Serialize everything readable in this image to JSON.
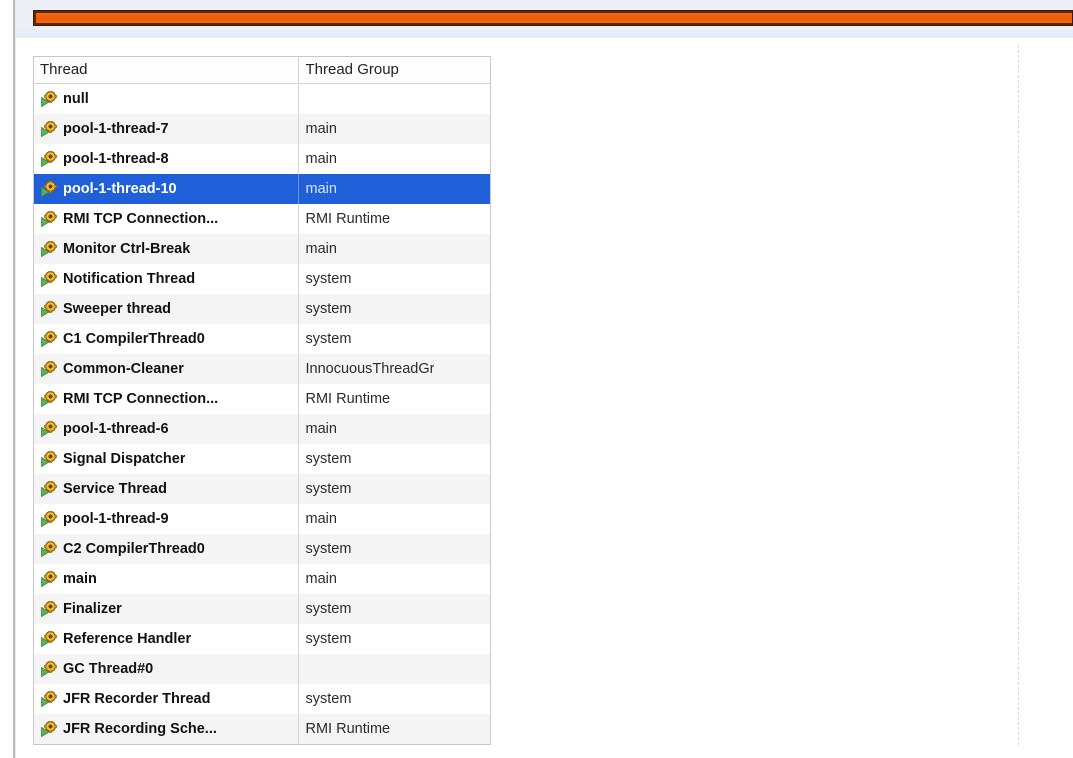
{
  "window": {
    "progress_bar": {
      "name": "orange-level-bar",
      "fill_color": "#ef5f06",
      "border_color": "#5d2a09",
      "fill_percent": 100
    }
  },
  "thread_table": {
    "columns": [
      "Thread",
      "Thread Group"
    ],
    "selected_row_index": 3,
    "selection_color": "#1f5fd8",
    "row_icon": "thread-run-gear-icon",
    "rows": [
      {
        "thread": "null",
        "group": ""
      },
      {
        "thread": "pool-1-thread-7",
        "group": "main"
      },
      {
        "thread": "pool-1-thread-8",
        "group": "main"
      },
      {
        "thread": "pool-1-thread-10",
        "group": "main"
      },
      {
        "thread": "RMI TCP Connection...",
        "group": "RMI Runtime"
      },
      {
        "thread": "Monitor Ctrl-Break",
        "group": "main"
      },
      {
        "thread": "Notification Thread",
        "group": "system"
      },
      {
        "thread": "Sweeper thread",
        "group": "system"
      },
      {
        "thread": "C1 CompilerThread0",
        "group": "system"
      },
      {
        "thread": "Common-Cleaner",
        "group": "InnocuousThreadGr"
      },
      {
        "thread": "RMI TCP Connection...",
        "group": "RMI Runtime"
      },
      {
        "thread": "pool-1-thread-6",
        "group": "main"
      },
      {
        "thread": "Signal Dispatcher",
        "group": "system"
      },
      {
        "thread": "Service Thread",
        "group": "system"
      },
      {
        "thread": "pool-1-thread-9",
        "group": "main"
      },
      {
        "thread": "C2 CompilerThread0",
        "group": "system"
      },
      {
        "thread": "main",
        "group": "main"
      },
      {
        "thread": "Finalizer",
        "group": "system"
      },
      {
        "thread": "Reference Handler",
        "group": "system"
      },
      {
        "thread": "GC Thread#0",
        "group": ""
      },
      {
        "thread": "JFR Recorder Thread",
        "group": "system"
      },
      {
        "thread": "JFR Recording Sche...",
        "group": "RMI Runtime"
      }
    ]
  }
}
